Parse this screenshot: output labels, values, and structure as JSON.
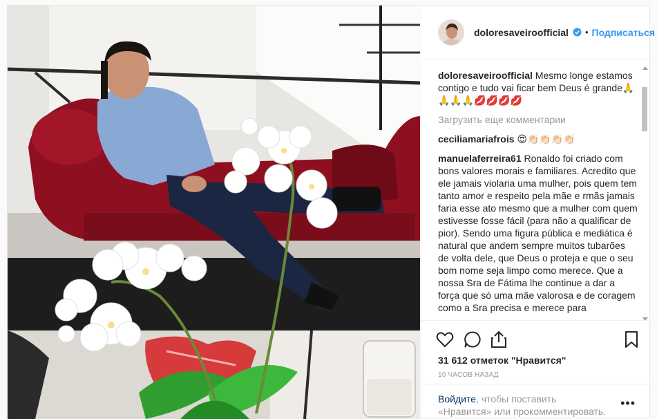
{
  "header": {
    "username": "doloresaveiroofficial",
    "follow_label": "Подписаться",
    "separator": "•"
  },
  "caption": {
    "username": "doloresaveiroofficial",
    "text": "Mesmo longe estamos contigo e tudo vai ficar bem Deus é grande🙏🙏🙏🙏💋💋💋💋"
  },
  "load_more_label": "Загрузить еще комментарии",
  "comments": [
    {
      "username": "ceciliamariafrois",
      "text": "😍👏🏻👏🏻👏🏻👏🏻"
    },
    {
      "username": "manuelaferreira61",
      "text": "Ronaldo foi criado com bons valores morais e familiares. Acredito que ele jamais violaria uma mulher, pois quem tem tanto amor e respeito pela mãe e rmãs jamais faria esse ato mesmo que a mulher com quem estivesse fosse fácil (para não a qualificar de pior). Sendo uma figura pública e mediática é natural que andem sempre muitos tubarões de volta dele, que Deus o proteja e que o seu bom nome seja limpo como merece. Que a nossa Sra de Fátima lhe continue a dar a força que só uma mãe valorosa e de coragem como a Sra precisa e merece para"
    }
  ],
  "icons": {
    "like": "heart-icon",
    "comment": "comment-icon",
    "share": "share-icon",
    "save": "bookmark-icon",
    "verified": "verified-badge-icon",
    "more": "more-options-icon"
  },
  "likes_text": "31 612 отметок \"Нравится\"",
  "timestamp": "10 часов назад",
  "login": {
    "link_text": "Войдите",
    "rest_text": ", чтобы поставить «Нравится» или прокомментировать."
  },
  "more_label": "•••",
  "colors": {
    "link_blue": "#3897f0",
    "verified_blue": "#3897f0",
    "muted": "#999999",
    "text": "#262626",
    "sofa_red": "#8e1020"
  }
}
